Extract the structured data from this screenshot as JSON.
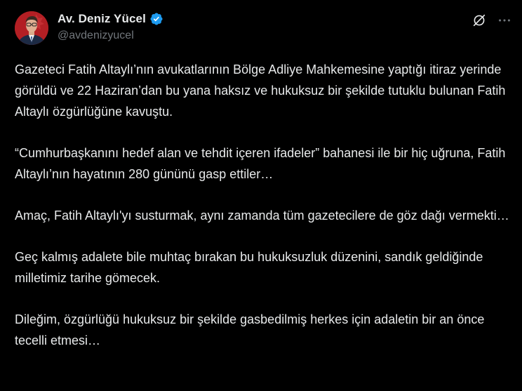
{
  "author": {
    "display_name": "Av. Deniz Yücel",
    "handle": "@avdenizyucel",
    "verified": true,
    "verified_color": "#1d9bf0"
  },
  "actions": {
    "grok_icon": "grok-icon",
    "more_icon": "more-icon"
  },
  "post": {
    "paragraphs": [
      "Gazeteci Fatih Altaylı’nın avukatlarının Bölge Adliye Mahkemesine yaptığı itiraz yerinde görüldü ve 22 Haziran’dan bu yana haksız ve hukuksuz bir şekilde tutuklu bulunan Fatih Altaylı özgürlüğüne kavuştu.",
      "“Cumhurbaşkanını hedef alan ve tehdit içeren ifadeler” bahanesi ile bir hiç uğruna, Fatih Altaylı’nın hayatının 280 gününü gasp ettiler…",
      "Amaç, Fatih Altaylı'yı susturmak, aynı zamanda tüm gazetecilere de göz dağı vermekti…",
      "Geç kalmış adalete bile muhtaç bırakan bu hukuksuzluk düzenini, sandık geldiğinde milletimiz tarihe gömecek.",
      "Dileğim, özgürlüğü hukuksuz bir şekilde gasbedilmiş herkes için adaletin bir an önce tecelli etmesi…"
    ]
  },
  "colors": {
    "background": "#000000",
    "text_primary": "#e7e9ea",
    "text_secondary": "#71767b"
  }
}
